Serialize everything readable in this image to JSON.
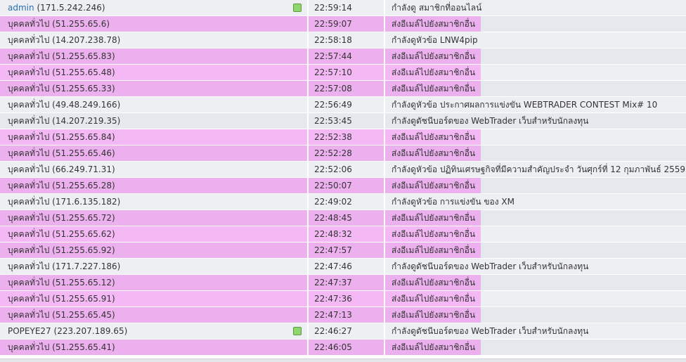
{
  "rows": [
    {
      "user": "admin",
      "ip": "(171.5.242.246)",
      "time": "22:59:14",
      "activity": "กำลังดู สมาชิกที่ออนไลน์",
      "highlight": false,
      "online": true,
      "user_style": "admin"
    },
    {
      "user": "บุคคลทั่วไป",
      "ip": "(51.255.65.6)",
      "time": "22:59:07",
      "activity": "ส่งอีเมล์ไปยังสมาชิกอื่น",
      "highlight": true,
      "partial": true
    },
    {
      "user": "บุคคลทั่วไป",
      "ip": "(14.207.238.78)",
      "time": "22:58:18",
      "activity": "กำลังดูหัวข้อ LNW4pip",
      "highlight": false
    },
    {
      "user": "บุคคลทั่วไป",
      "ip": "(51.255.65.83)",
      "time": "22:57:44",
      "activity": "ส่งอีเมล์ไปยังสมาชิกอื่น",
      "highlight": true
    },
    {
      "user": "บุคคลทั่วไป",
      "ip": "(51.255.65.48)",
      "time": "22:57:10",
      "activity": "ส่งอีเมล์ไปยังสมาชิกอื่น",
      "highlight": true
    },
    {
      "user": "บุคคลทั่วไป",
      "ip": "(51.255.65.33)",
      "time": "22:57:08",
      "activity": "ส่งอีเมล์ไปยังสมาชิกอื่น",
      "highlight": true
    },
    {
      "user": "บุคคลทั่วไป",
      "ip": "(49.48.249.166)",
      "time": "22:56:49",
      "activity": "กำลังดูหัวข้อ ประกาศผลการแข่งขัน WEBTRADER CONTEST Mix# 10",
      "highlight": false
    },
    {
      "user": "บุคคลทั่วไป",
      "ip": "(14.207.219.35)",
      "time": "22:53:45",
      "activity": "กำลังดูดัชนีบอร์ดของ WebTrader เว็บสำหรับนักลงทุน",
      "highlight": false
    },
    {
      "user": "บุคคลทั่วไป",
      "ip": "(51.255.65.84)",
      "time": "22:52:38",
      "activity": "ส่งอีเมล์ไปยังสมาชิกอื่น",
      "highlight": true
    },
    {
      "user": "บุคคลทั่วไป",
      "ip": "(51.255.65.46)",
      "time": "22:52:28",
      "activity": "ส่งอีเมล์ไปยังสมาชิกอื่น",
      "highlight": true
    },
    {
      "user": "บุคคลทั่วไป",
      "ip": "(66.249.71.31)",
      "time": "22:52:06",
      "activity": "กำลังดูหัวข้อ ปฏิทินเศรษฐกิจที่มีความสำคัญประจำ วันศุกร์ที่ 12 กุมภาพันธ์ 2559",
      "highlight": false
    },
    {
      "user": "บุคคลทั่วไป",
      "ip": "(51.255.65.28)",
      "time": "22:50:07",
      "activity": "ส่งอีเมล์ไปยังสมาชิกอื่น",
      "highlight": true
    },
    {
      "user": "บุคคลทั่วไป",
      "ip": "(171.6.135.182)",
      "time": "22:49:02",
      "activity": "กำลังดูหัวข้อ การแข่งขัน ของ XM",
      "highlight": false
    },
    {
      "user": "บุคคลทั่วไป",
      "ip": "(51.255.65.72)",
      "time": "22:48:45",
      "activity": "ส่งอีเมล์ไปยังสมาชิกอื่น",
      "highlight": true
    },
    {
      "user": "บุคคลทั่วไป",
      "ip": "(51.255.65.62)",
      "time": "22:48:32",
      "activity": "ส่งอีเมล์ไปยังสมาชิกอื่น",
      "highlight": true
    },
    {
      "user": "บุคคลทั่วไป",
      "ip": "(51.255.65.92)",
      "time": "22:47:57",
      "activity": "ส่งอีเมล์ไปยังสมาชิกอื่น",
      "highlight": true
    },
    {
      "user": "บุคคลทั่วไป",
      "ip": "(171.7.227.186)",
      "time": "22:47:46",
      "activity": "กำลังดูดัชนีบอร์ดของ WebTrader เว็บสำหรับนักลงทุน",
      "highlight": false
    },
    {
      "user": "บุคคลทั่วไป",
      "ip": "(51.255.65.12)",
      "time": "22:47:37",
      "activity": "ส่งอีเมล์ไปยังสมาชิกอื่น",
      "highlight": true
    },
    {
      "user": "บุคคลทั่วไป",
      "ip": "(51.255.65.91)",
      "time": "22:47:36",
      "activity": "ส่งอีเมล์ไปยังสมาชิกอื่น",
      "highlight": true
    },
    {
      "user": "บุคคลทั่วไป",
      "ip": "(51.255.65.45)",
      "time": "22:47:13",
      "activity": "ส่งอีเมล์ไปยังสมาชิกอื่น",
      "highlight": true
    },
    {
      "user": "POPEYE27",
      "ip": "(223.207.189.65)",
      "time": "22:46:27",
      "activity": "กำลังดูดัชนีบอร์ดของ WebTrader เว็บสำหรับนักลงทุน",
      "highlight": false,
      "online": true
    },
    {
      "user": "บุคคลทั่วไป",
      "ip": "(51.255.65.41)",
      "time": "22:46:05",
      "activity": "ส่งอีเมล์ไปยังสมาชิกอื่น",
      "highlight": true
    }
  ],
  "colors": {
    "highlight": "#f4b8f5",
    "row_light": "#edeff2",
    "row_dark": "#e5e8ec",
    "admin_link": "#2a6eb0",
    "online_icon": "#8fd66f"
  },
  "icons": {
    "online": "online-status-icon"
  }
}
